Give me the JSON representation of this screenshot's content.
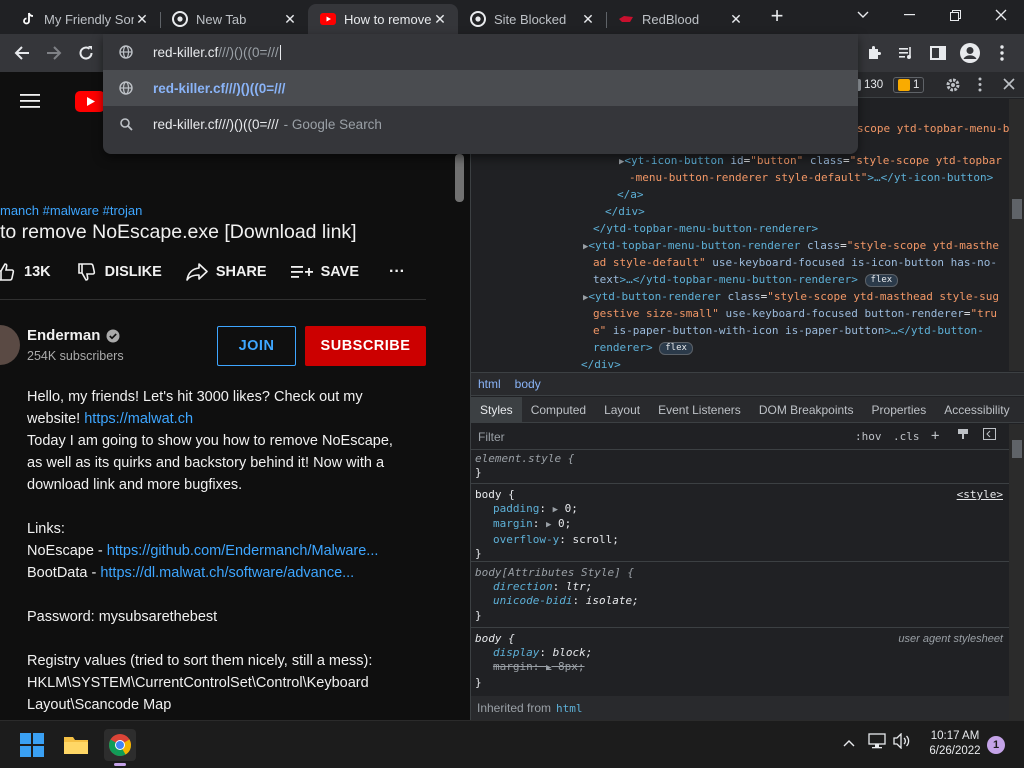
{
  "tabs": [
    {
      "title": "My Friendly Son",
      "favicon": "tiktok-icon",
      "active": false
    },
    {
      "title": "New Tab",
      "favicon": "chrome-icon",
      "active": false
    },
    {
      "title": "How to remove",
      "favicon": "youtube-icon",
      "active": true
    },
    {
      "title": "Site Blocked",
      "favicon": "chrome-icon",
      "active": false
    },
    {
      "title": "RedBlood",
      "favicon": "redblood-icon",
      "active": false
    }
  ],
  "omnibox": {
    "typed": "red-killer.cf",
    "autocomplete": "///)()((0=///",
    "suggestions": [
      {
        "text": "red-killer.cf///)()((0=///",
        "suffix": "",
        "icon": "globe-icon"
      },
      {
        "text": "red-killer.cf///)()((0=///",
        "suffix": "- Google Search",
        "icon": "search-icon"
      }
    ]
  },
  "video": {
    "tags": "manch #malware #trojan",
    "title": "to remove NoEscape.exe [Download link]",
    "likes": "13K",
    "dislike_label": "DISLIKE",
    "share_label": "SHARE",
    "save_label": "SAVE",
    "more_label": "···"
  },
  "channel": {
    "name": "Enderman",
    "subscribers": "254K subscribers",
    "join_label": "JOIN",
    "subscribe_label": "SUBSCRIBE"
  },
  "description": {
    "l1": "Hello, my friends! Let's hit 3000 likes? Check out my",
    "l2a": "website! ",
    "l2link": "https://malwat.ch",
    "l3": "Today I am going to show you how to remove NoEscape,",
    "l4": "as well as its quirks and backstory behind it! Now with a",
    "l5": "download link and more bugfixes.",
    "l7": "Links:",
    "l8a": "NoEscape - ",
    "l8link": "https://github.com/Endermanch/Malware...",
    "l9a": "BootData - ",
    "l9link": "https://dl.malwat.ch/software/advance...",
    "l11": "Password: mysubsarethebest",
    "l13": "Registry values (tried to sort them nicely, still a mess):",
    "l14": "HKLM\\SYSTEM\\CurrentControlSet\\Control\\Keyboard",
    "l15": "Layout\\Scancode Map"
  },
  "devtools": {
    "issues_errors": "130",
    "issues_warnings": "1",
    "elements": {
      "l0a": "scope ytd-topbar-menu-bu",
      "l1_tag": "<yt-icon-button",
      "l1_a1": "id",
      "l1_v1": "\"button\"",
      "l1_a2": "class",
      "l1_v2": "\"style-scope ytd-topbar",
      "l2_v": "-menu-button-renderer style-default\"",
      "l2_end": ">…</yt-icon-button>",
      "l3": "</a>",
      "l4": "</div>",
      "l5": "</ytd-topbar-menu-button-renderer>",
      "l6_tag": "<ytd-topbar-menu-button-renderer",
      "l6_a": "class",
      "l6_v": "\"style-scope ytd-masthe",
      "l7_v": "ad style-default\"",
      "l7_rest": "use-keyboard-focused is-icon-button has-no-",
      "l8_rest": "text",
      "l8_end": ">…</ytd-topbar-menu-button-renderer>",
      "l9_tag": "<ytd-button-renderer",
      "l9_a": "class",
      "l9_v": "\"style-scope ytd-masthead style-sug",
      "l10_v": "gestive size-small\"",
      "l10_a": "use-keyboard-focused button-renderer",
      "l10_v2": "\"tru",
      "l11_v": "e\"",
      "l11_rest": "is-paper-button-with-icon is-paper-button",
      "l11_end": ">…</ytd-button-",
      "l12": "renderer>",
      "l13": "</div>",
      "flex": "flex"
    },
    "crumbs": [
      "html",
      "body"
    ],
    "subtabs": [
      "Styles",
      "Computed",
      "Layout",
      "Event Listeners",
      "DOM Breakpoints",
      "Properties",
      "Accessibility"
    ],
    "filter_placeholder": "Filter",
    "hov": ":hov",
    "cls": ".cls",
    "rules": {
      "r1_sel": "element.style {",
      "close": "}",
      "r2_sel": "body {",
      "r2_src": "<style>",
      "r2_p1n": "padding",
      "r2_p1v": "0;",
      "r2_p2n": "margin",
      "r2_p2v": "0;",
      "r2_p3n": "overflow-y",
      "r2_p3v": "scroll;",
      "r3_sel": "body[Attributes Style] {",
      "r3_p1n": "direction",
      "r3_p1v": "ltr;",
      "r3_p2n": "unicode-bidi",
      "r3_p2v": "isolate;",
      "r4_sel": "body {",
      "r4_src": "user agent stylesheet",
      "r4_p1n": "display",
      "r4_p1v": "block;",
      "r4_p2n": "margin",
      "r4_p2v": "8px;"
    },
    "inherited_label": "Inherited from",
    "inherited_tag": "html"
  },
  "taskbar": {
    "time": "10:17 AM",
    "date": "6/26/2022",
    "notifications": "1"
  },
  "colors": {
    "yt_red": "#cc0000",
    "link_blue": "#3ea6ff",
    "devtools_tag": "#5db0d7"
  }
}
